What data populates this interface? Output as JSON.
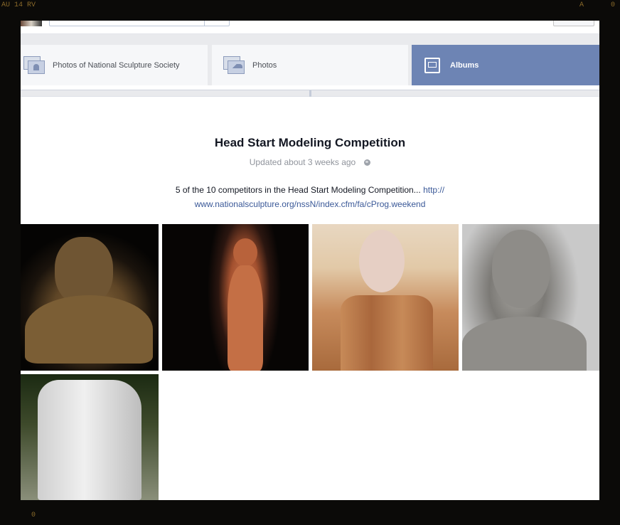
{
  "frame": {
    "top_left_label": "AU 14 RV",
    "top_right_label_1": "A",
    "top_right_label_2": "0",
    "bottom_left_label": "0"
  },
  "tabs": [
    {
      "label": "Photos of National Sculpture Society",
      "icon": "photos-of-icon",
      "active": false
    },
    {
      "label": "Photos",
      "icon": "photos-icon",
      "active": false
    },
    {
      "label": "Albums",
      "icon": "albums-icon",
      "active": true
    }
  ],
  "album": {
    "title": "Head Start Modeling Competition",
    "updated": "Updated about 3 weeks ago",
    "privacy_icon": "globe-icon",
    "description": "5 of the 10 competitors in the Head Start Modeling Competition...",
    "link_line1": "http://",
    "link_line2": "www.nationalsculpture.org/nssN/index.cfm/fa/cProg.weekend"
  },
  "colors": {
    "active_tab": "#6d84b4",
    "link": "#3b5998",
    "title_text": "#141823",
    "meta_text": "#90949c"
  }
}
